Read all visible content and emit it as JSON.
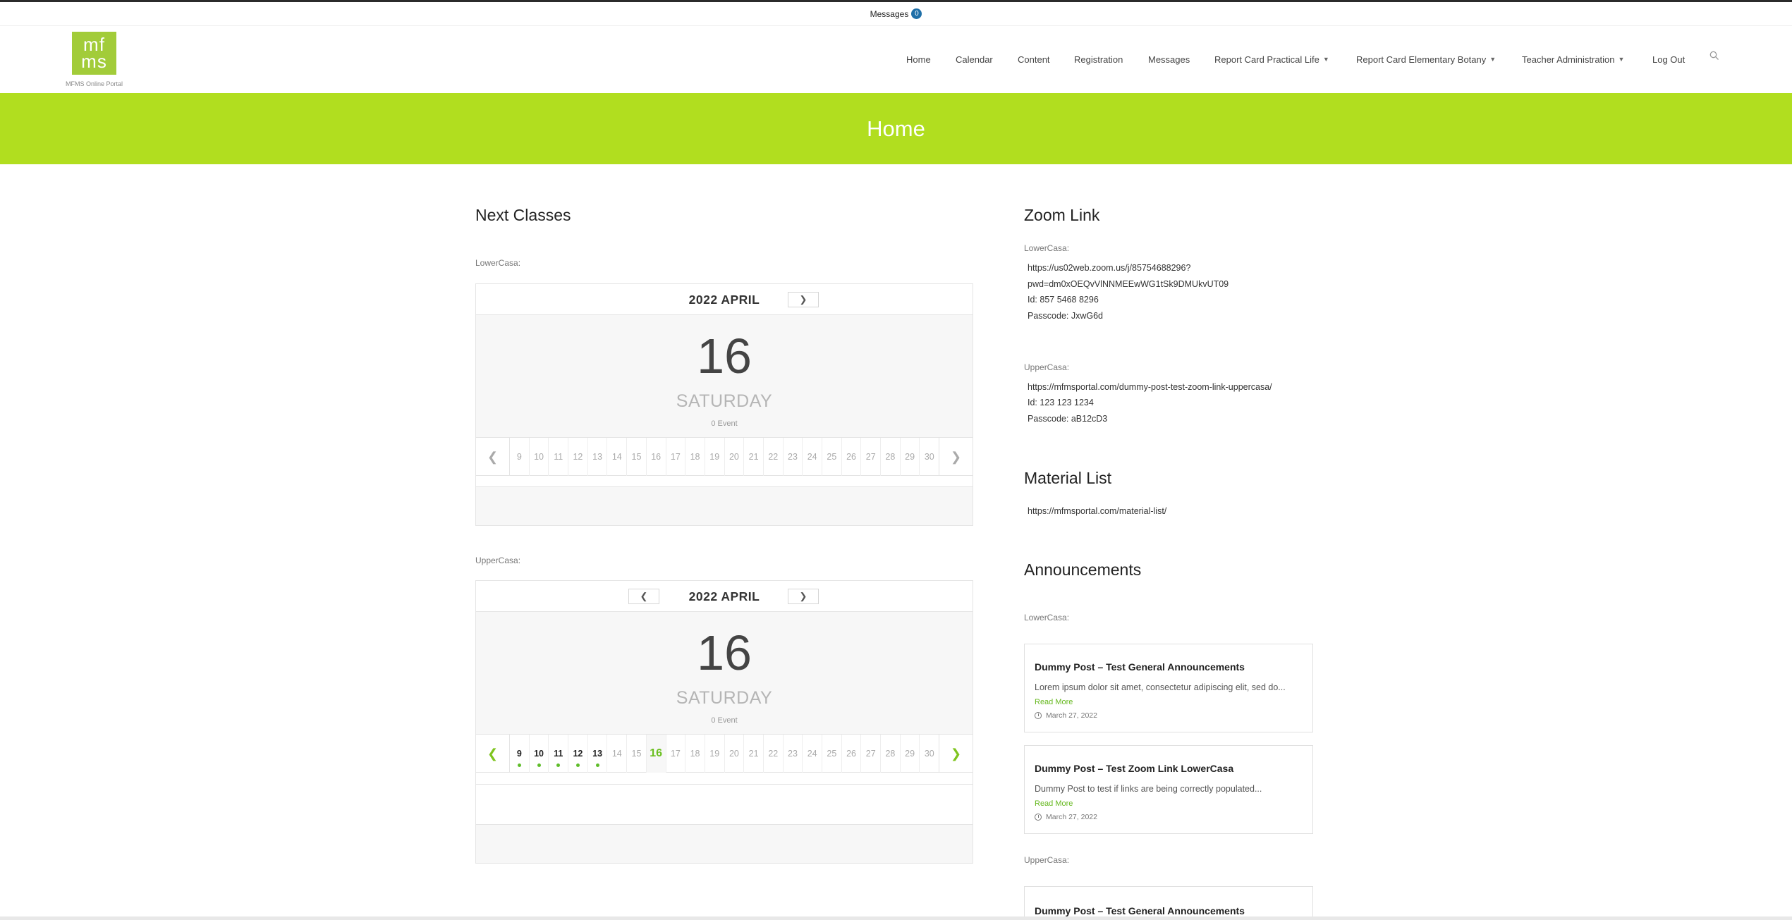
{
  "topbar": {
    "messages_label": "Messages",
    "messages_count": "0"
  },
  "logo": {
    "line1": "mf",
    "line2": "ms",
    "caption": "MFMS Online Portal"
  },
  "nav": {
    "home": "Home",
    "calendar": "Calendar",
    "content": "Content",
    "registration": "Registration",
    "messages": "Messages",
    "rc_practical": "Report Card Practical Life",
    "rc_botany": "Report Card Elementary Botany",
    "teacher_admin": "Teacher Administration",
    "logout": "Log Out"
  },
  "banner": {
    "title": "Home"
  },
  "next_classes": {
    "heading": "Next Classes",
    "calendars": [
      {
        "label": "LowerCasa:",
        "month": "2022 APRIL",
        "day_number": "16",
        "weekday": "SATURDAY",
        "events": "0 Event",
        "days": [
          "9",
          "10",
          "11",
          "12",
          "13",
          "14",
          "15",
          "16",
          "17",
          "18",
          "19",
          "20",
          "21",
          "22",
          "23",
          "24",
          "25",
          "26",
          "27",
          "28",
          "29",
          "30"
        ]
      },
      {
        "label": "UpperCasa:",
        "month": "2022 APRIL",
        "day_number": "16",
        "weekday": "SATURDAY",
        "events": "0 Event",
        "days": [
          "9",
          "10",
          "11",
          "12",
          "13",
          "14",
          "15",
          "16",
          "17",
          "18",
          "19",
          "20",
          "21",
          "22",
          "23",
          "24",
          "25",
          "26",
          "27",
          "28",
          "29",
          "30"
        ]
      }
    ]
  },
  "zoom": {
    "heading": "Zoom Link",
    "lower_label": "LowerCasa:",
    "lower_url_line1": "https://us02web.zoom.us/j/85754688296?",
    "lower_url_line2": "pwd=dm0xOEQvVlNNMEEwWG1tSk9DMUkvUT09",
    "lower_id": "Id: 857 5468 8296",
    "lower_pass": "Passcode: JxwG6d",
    "upper_label": "UpperCasa:",
    "upper_url": "https://mfmsportal.com/dummy-post-test-zoom-link-uppercasa/",
    "upper_id": "Id: 123 123 1234",
    "upper_pass": "Passcode: aB12cD3"
  },
  "material": {
    "heading": "Material List",
    "url": "https://mfmsportal.com/material-list/"
  },
  "announcements": {
    "heading": "Announcements",
    "lower_label": "LowerCasa:",
    "upper_label": "UpperCasa:",
    "cards": [
      {
        "title": "Dummy Post – Test General Announcements",
        "excerpt": "Lorem ipsum dolor sit amet, consectetur adipiscing elit, sed do...",
        "more": "Read More",
        "date": "March 27, 2022"
      },
      {
        "title": "Dummy Post – Test Zoom Link LowerCasa",
        "excerpt": "Dummy Post to test if links are being correctly populated...",
        "more": "Read More",
        "date": "March 27, 2022"
      },
      {
        "title": "Dummy Post – Test General Announcements"
      }
    ]
  }
}
